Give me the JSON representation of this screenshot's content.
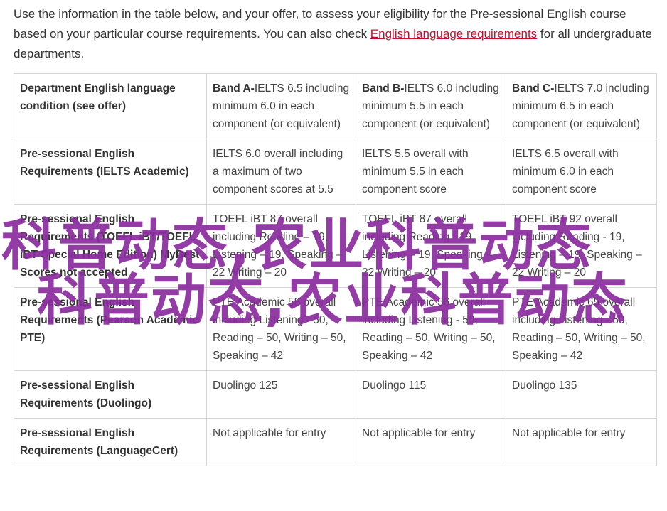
{
  "intro": {
    "before_link": "Use the information in the table below, and your offer, to assess your eligibility for the Pre-sessional English course based on your particular course requirements. You can also check ",
    "link_text": "English language requirements",
    "after_link": " for all undergraduate departments."
  },
  "table": {
    "header": {
      "condition": "Department English language condition (see offer)",
      "band_a_label": "Band A-",
      "band_a_text": "IELTS 6.5 including minimum 6.0 in each component (or equivalent)",
      "band_b_label": "Band B-",
      "band_b_text": "IELTS 6.0 including minimum 5.5 in each component (or equivalent)",
      "band_c_label": "Band C-",
      "band_c_text": "IELTS 7.0 including minimum 6.5 in each component (or equivalent)"
    },
    "rows": [
      {
        "label": "Pre-sessional English Requirements (IELTS Academic)",
        "a": "IELTS 6.0 overall including a maximum of two component scores at 5.5",
        "b": "IELTS 5.5 overall with minimum 5.5 in each component score",
        "c": "IELTS 6.5 overall with minimum 6.0 in each component score"
      },
      {
        "label": "Pre-sessional English Requirements (TOEFL iBT/TOEFL iBT Special Home Edition) MyBest Scores not accepted",
        "a": "TOEFL iBT 87 overall including Reading – 19, Listening – 19, Speaking – 22 Writing – 20",
        "b": "TOEFL iBT 87 overall including Reading - 19, Listening – 19, Speaking – 22 Writing – 20",
        "c": "TOEFL iBT 92 overall including Reading - 19, Listening – 19, Speaking – 22 Writing – 20"
      },
      {
        "label": "Pre-sessional English Requirements (Pearson Academic PTE)",
        "a": "PTE Academic 58 overall including Listening - 50, Reading – 50, Writing – 50, Speaking – 42",
        "b": "PTE Academic 56 overall including Listening - 50, Reading – 50, Writing – 50, Speaking – 42",
        "c": "PTE Academic 65 overall including Listening - 50, Reading – 50, Writing – 50, Speaking – 42"
      },
      {
        "label": "Pre-sessional English Requirements (Duolingo)",
        "a": "Duolingo 125",
        "b": "Duolingo 115",
        "c": "Duolingo 135"
      },
      {
        "label": "Pre-sessional English Requirements (LanguageCert)",
        "a": "Not applicable for entry",
        "b": "Not applicable for entry",
        "c": "Not applicable for entry"
      }
    ]
  },
  "watermark": {
    "line1": "科普动态,农业科普动态",
    "line2": "科普动态,农业科普动态"
  },
  "colors": {
    "link": "#c8102e",
    "watermark": "#8b2c9f",
    "border": "#d5d5d5"
  }
}
